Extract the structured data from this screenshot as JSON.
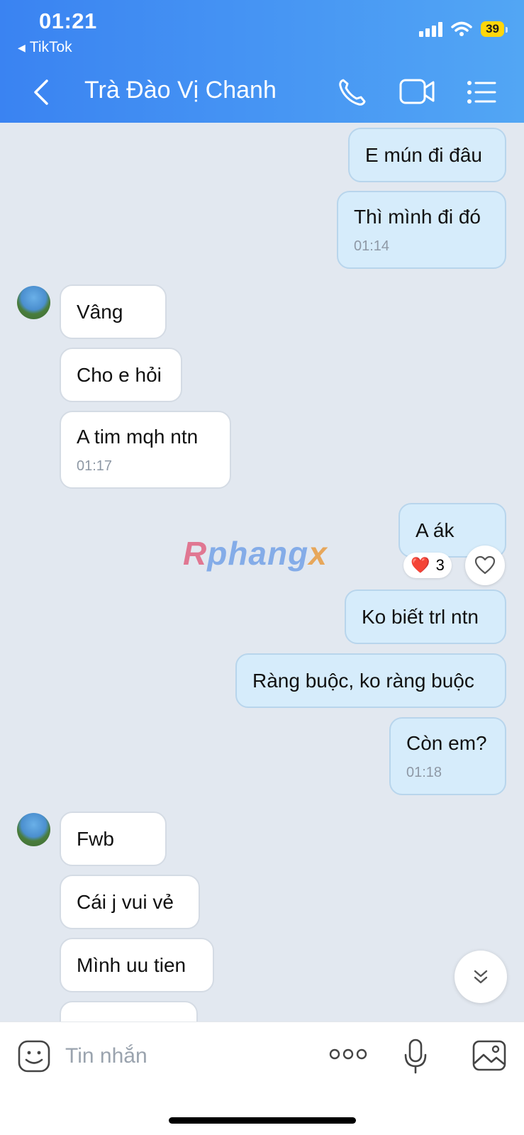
{
  "status_bar": {
    "time": "01:21",
    "back_app": "TikTok",
    "battery": "39"
  },
  "header": {
    "title": "Trà Đào Vị Chanh"
  },
  "messages": [
    {
      "text": "E mún đi đâu"
    },
    {
      "text": "Thì mình đi đó",
      "time": "01:14"
    },
    {
      "text": "Vâng"
    },
    {
      "text": "Cho e hỏi"
    },
    {
      "text": "A tim mqh ntn",
      "time": "01:17"
    },
    {
      "text": "A ák"
    },
    {
      "text": "Ko biết trl ntn"
    },
    {
      "text": "Ràng buộc, ko ràng buộc"
    },
    {
      "text": "Còn em?",
      "time": "01:18"
    },
    {
      "text": "Fwb"
    },
    {
      "text": "Cái j vui vẻ"
    },
    {
      "text": "Mình uu tien"
    }
  ],
  "reaction": {
    "emoji": "❤️",
    "count": "3"
  },
  "watermark": {
    "part1": "R",
    "part2": "phang",
    "part3": "x"
  },
  "composer": {
    "placeholder": "Tin nhắn"
  },
  "colors": {
    "header_start": "#3a83f2",
    "header_end": "#52a6f4",
    "outgoing": "#d6ecfb",
    "incoming": "#ffffff",
    "background": "#e2e8f0"
  },
  "icons": [
    "back-arrow-icon",
    "phone-icon",
    "video-call-icon",
    "menu-list-icon",
    "heart-icon",
    "chevron-double-down-icon",
    "sticker-icon",
    "more-icon",
    "microphone-icon",
    "image-icon"
  ]
}
